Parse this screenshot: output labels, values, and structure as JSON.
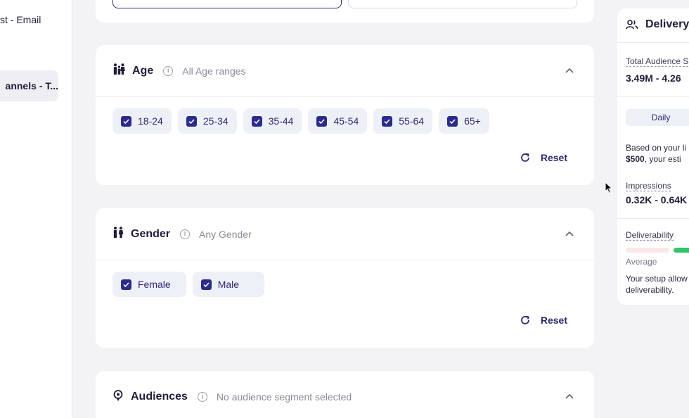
{
  "sidebar": {
    "items": [
      {
        "label": "st - Email"
      },
      {
        "label": "annels - T..."
      }
    ]
  },
  "age_card": {
    "title": "Age",
    "subtitle": "All Age ranges",
    "options": [
      "18-24",
      "25-34",
      "35-44",
      "45-54",
      "55-64",
      "65+"
    ],
    "reset_label": "Reset"
  },
  "gender_card": {
    "title": "Gender",
    "subtitle": "Any Gender",
    "options": [
      "Female",
      "Male"
    ],
    "reset_label": "Reset"
  },
  "audiences_card": {
    "title": "Audiences",
    "subtitle": "No audience segment selected"
  },
  "delivery_panel": {
    "title": "Delivery",
    "total_audience_label": "Total Audience S",
    "total_audience_value": "3.49M - 4.26",
    "daily_label": "Daily",
    "budget_line1": "Based on your li",
    "budget_line2_bold": "$500",
    "budget_line2_rest": ", your esti",
    "impressions_label": "Impressions",
    "impressions_value": "0.32K - 0.64K",
    "deliverability_label": "Deliverability",
    "deliverability_level": "Average",
    "setup_line1": "Your setup allow",
    "setup_line2": "deliverability."
  },
  "colors": {
    "accent": "#2b2b8c",
    "chip_bg": "#eef0f8",
    "green": "#34c46a",
    "pink": "#fbe7ea"
  }
}
